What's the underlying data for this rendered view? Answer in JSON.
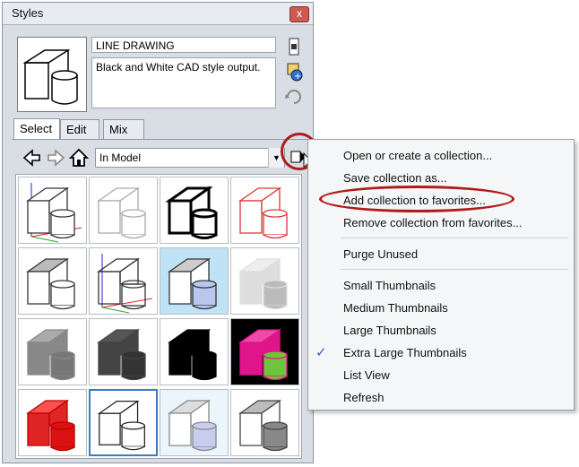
{
  "panel": {
    "title": "Styles",
    "close_glyph": "x",
    "style_name": "LINE DRAWING",
    "style_description": "Black and White CAD style output.",
    "tabs": [
      {
        "label": "Select"
      },
      {
        "label": "Edit"
      },
      {
        "label": "Mix"
      }
    ],
    "collection": "In Model",
    "icons": [
      "create-style-icon",
      "update-style-icon",
      "refresh-icon",
      "back-icon",
      "forward-icon",
      "home-icon",
      "details-icon"
    ]
  },
  "thumbnails": [
    {
      "name": "color-axes-wireframe",
      "style": "axes"
    },
    {
      "name": "faint-line",
      "style": "faint"
    },
    {
      "name": "bold-line",
      "style": "bold"
    },
    {
      "name": "red-line",
      "style": "red"
    },
    {
      "name": "gray-shaded",
      "style": "gray"
    },
    {
      "name": "xray-axes",
      "style": "xray"
    },
    {
      "name": "sky-blue",
      "style": "sky"
    },
    {
      "name": "light-gray-solid",
      "style": "lightgray"
    },
    {
      "name": "medium-gray-solid",
      "style": "midgray"
    },
    {
      "name": "dark-gray-solid",
      "style": "darkgray"
    },
    {
      "name": "black-silhouette",
      "style": "black"
    },
    {
      "name": "magenta-green",
      "style": "magenta"
    },
    {
      "name": "red-solid",
      "style": "redsolid"
    },
    {
      "name": "line-drawing-selected",
      "style": "selected"
    },
    {
      "name": "blue-hatch",
      "style": "bluehatch"
    },
    {
      "name": "gray-cylinder",
      "style": "graycyl"
    }
  ],
  "menu": {
    "items": [
      {
        "label": "Open or create a collection..."
      },
      {
        "label": "Save collection as..."
      },
      {
        "label": "Add collection to favorites..."
      },
      {
        "label": "Remove collection from favorites..."
      },
      {
        "label": "Purge Unused"
      },
      {
        "label": "Small Thumbnails"
      },
      {
        "label": "Medium Thumbnails"
      },
      {
        "label": "Large Thumbnails"
      },
      {
        "label": "Extra Large Thumbnails"
      },
      {
        "label": "List View"
      },
      {
        "label": "Refresh"
      }
    ],
    "checked_item": "Extra Large Thumbnails",
    "check_glyph": "✓"
  },
  "colors": {
    "annotation": "#b01b1b",
    "selection": "#3b7ac8",
    "check": "#2a62c4"
  }
}
